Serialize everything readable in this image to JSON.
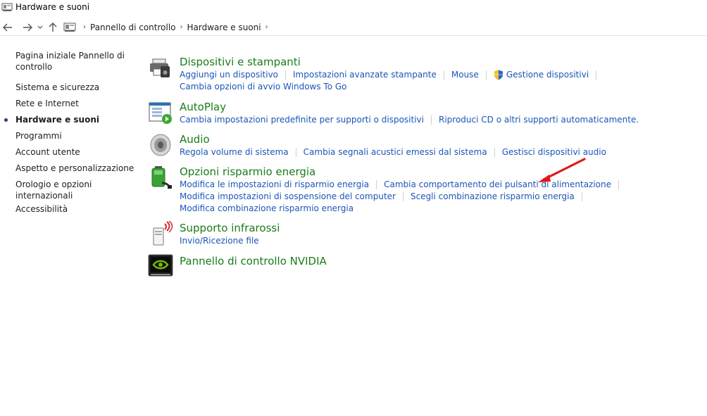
{
  "window": {
    "title": "Hardware e suoni"
  },
  "breadcrumb": [
    "Pannello di controllo",
    "Hardware e suoni"
  ],
  "sidebar": {
    "items": [
      {
        "label": "Pagina iniziale Pannello di",
        "label2": "controllo"
      },
      {
        "label": "Sistema e sicurezza"
      },
      {
        "label": "Rete e Internet"
      },
      {
        "label": "Hardware e suoni"
      },
      {
        "label": "Programmi"
      },
      {
        "label": "Account utente"
      },
      {
        "label": "Aspetto e personalizzazione"
      },
      {
        "label": "Orologio e opzioni",
        "label2": "internazionali"
      },
      {
        "label": "Accessibilità"
      }
    ]
  },
  "categories": [
    {
      "title": "Dispositivi e stampanti",
      "icon": "printer-icon",
      "links": [
        "Aggiungi un dispositivo",
        "Impostazioni avanzate stampante",
        "Mouse",
        "Gestione dispositivi",
        "Cambia opzioni di avvio Windows To Go"
      ]
    },
    {
      "title": "AutoPlay",
      "icon": "autoplay-icon",
      "links": [
        "Cambia impostazioni predefinite per supporti o dispositivi",
        "Riproduci CD o altri supporti automaticamente."
      ]
    },
    {
      "title": "Audio",
      "icon": "speaker-icon",
      "links": [
        "Regola volume di sistema",
        "Cambia segnali acustici emessi dal sistema",
        "Gestisci dispositivi audio"
      ]
    },
    {
      "title": "Opzioni risparmio energia",
      "icon": "battery-icon",
      "links": [
        "Modifica le impostazioni di risparmio energia",
        "Cambia comportamento dei pulsanti di alimentazione",
        "Modifica impostazioni di sospensione del computer",
        "Scegli combinazione risparmio energia",
        "Modifica combinazione risparmio energia"
      ]
    },
    {
      "title": "Supporto infrarossi",
      "icon": "infrared-icon",
      "links": [
        "Invio/Ricezione file"
      ]
    },
    {
      "title": "Pannello di controllo NVIDIA",
      "icon": "nvidia-icon",
      "links": []
    }
  ],
  "colors": {
    "link": "#1a56b8",
    "category_title": "#1a7c1a",
    "annotation_arrow": "#e0191b"
  }
}
